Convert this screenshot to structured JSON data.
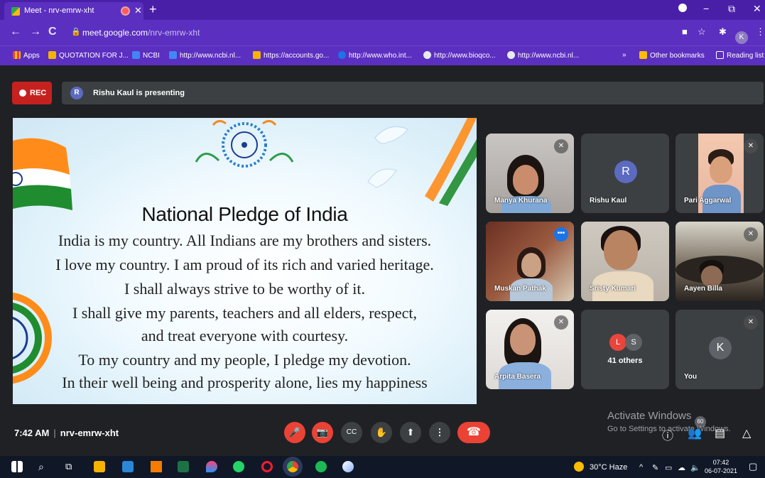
{
  "browser": {
    "tab_title": "Meet - nrv-emrw-xht",
    "new_tab": "+",
    "url_host": "meet.google.com",
    "url_path": "/nrv-emrw-xht",
    "profile_initial": "K",
    "window_controls": [
      "−",
      "⧉",
      "✕"
    ]
  },
  "bookmarks": [
    {
      "label": "Apps",
      "color": "#ea4335"
    },
    {
      "label": "QUOTATION FOR J...",
      "color": "#f4b400"
    },
    {
      "label": "NCBI",
      "color": "#4285f4"
    },
    {
      "label": "http://www.ncbi.nl...",
      "color": "#4285f4"
    },
    {
      "label": "https://accounts.go...",
      "color": "#f4b400"
    },
    {
      "label": "http://www.who.int...",
      "color": "#1a73e8"
    },
    {
      "label": "http://www.bioqco...",
      "color": "#e8eaed"
    },
    {
      "label": "http://www.ncbi.nl...",
      "color": "#e8eaed"
    }
  ],
  "bookmarks_right": {
    "overflow": "»",
    "other": "Other bookmarks",
    "reading": "Reading list"
  },
  "meet": {
    "rec_label": "REC",
    "presenter_initial": "R",
    "presenting_text": "Rishu Kaul is presenting",
    "time": "7:42 AM",
    "meeting_code": "nrv-emrw-xht"
  },
  "slide": {
    "title": "National Pledge of India",
    "lines": [
      "India is my country. All Indians are my brothers and sisters.",
      "I love my country. I am proud of its rich and varied heritage.",
      "I shall always strive to be worthy of it.",
      "I shall give my parents, teachers and all elders, respect,",
      "and treat everyone with courtesy.",
      "To my country and my people, I pledge my devotion.",
      "In their well being and prosperity alone, lies my happiness"
    ]
  },
  "participants": [
    {
      "name": "Manya Khurana",
      "muted": true
    },
    {
      "name": "Rishu Kaul",
      "initial": "R",
      "avatar_color": "#5c6bc0"
    },
    {
      "name": "Pari Aggarwal",
      "muted": true
    },
    {
      "name": "Muskan Pathak",
      "more": "•••"
    },
    {
      "name": "Sristy Kumari"
    },
    {
      "name": "Aayen Billa",
      "muted": true
    },
    {
      "name": "Arpita Basera",
      "muted": true
    },
    {
      "name": "41 others",
      "initials": [
        "L",
        "S"
      ],
      "colors": [
        "#e8453c",
        "#5f6368"
      ]
    },
    {
      "name": "You",
      "initial": "K",
      "avatar_color": "#5f6368",
      "muted": true
    }
  ],
  "controls": {
    "mic": "🎤",
    "cam": "📷",
    "cc": "CC",
    "hand": "✋",
    "present": "⬆",
    "more": "⋮",
    "end": "☎"
  },
  "watermark": {
    "line1": "Activate Windows",
    "line2": "Go to Settings to activate Windows.",
    "badge": "60"
  },
  "taskbar": {
    "weather": "30°C  Haze",
    "time": "07:42",
    "date": "06-07-2021"
  }
}
